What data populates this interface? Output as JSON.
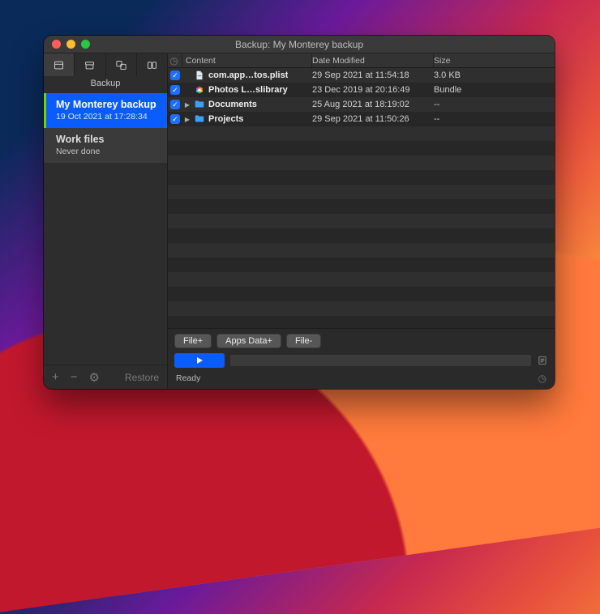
{
  "window": {
    "title": "Backup: My Monterey backup"
  },
  "sidebar": {
    "segment_label": "Backup",
    "tasks": [
      {
        "name": "My Monterey backup",
        "subtitle": "19 Oct 2021 at 17:28:34",
        "selected": true
      },
      {
        "name": "Work files",
        "subtitle": "Never done",
        "selected": false
      }
    ],
    "footer": {
      "add": "+",
      "remove": "−",
      "gear": "⚙︎",
      "restore": "Restore"
    }
  },
  "table": {
    "columns": {
      "content": "Content",
      "modified": "Date Modified",
      "size": "Size"
    },
    "rows": [
      {
        "checked": true,
        "expandable": false,
        "icon": "plist",
        "name": "com.app…tos.plist",
        "modified": "29 Sep 2021 at 11:54:18",
        "size": "3.0 KB"
      },
      {
        "checked": true,
        "expandable": false,
        "icon": "photos",
        "name": "Photos L…slibrary",
        "modified": "23 Dec 2019 at 20:16:49",
        "size": "Bundle"
      },
      {
        "checked": true,
        "expandable": true,
        "icon": "folder",
        "name": "Documents",
        "modified": "25 Aug 2021 at 18:19:02",
        "size": "--"
      },
      {
        "checked": true,
        "expandable": true,
        "icon": "folder",
        "name": "Projects",
        "modified": "29 Sep 2021 at 11:50:26",
        "size": "--"
      }
    ]
  },
  "toolbar": {
    "buttons": {
      "file_plus": "File+",
      "apps_data_plus": "Apps Data+",
      "file_minus": "File-"
    }
  },
  "status": {
    "text": "Ready"
  }
}
